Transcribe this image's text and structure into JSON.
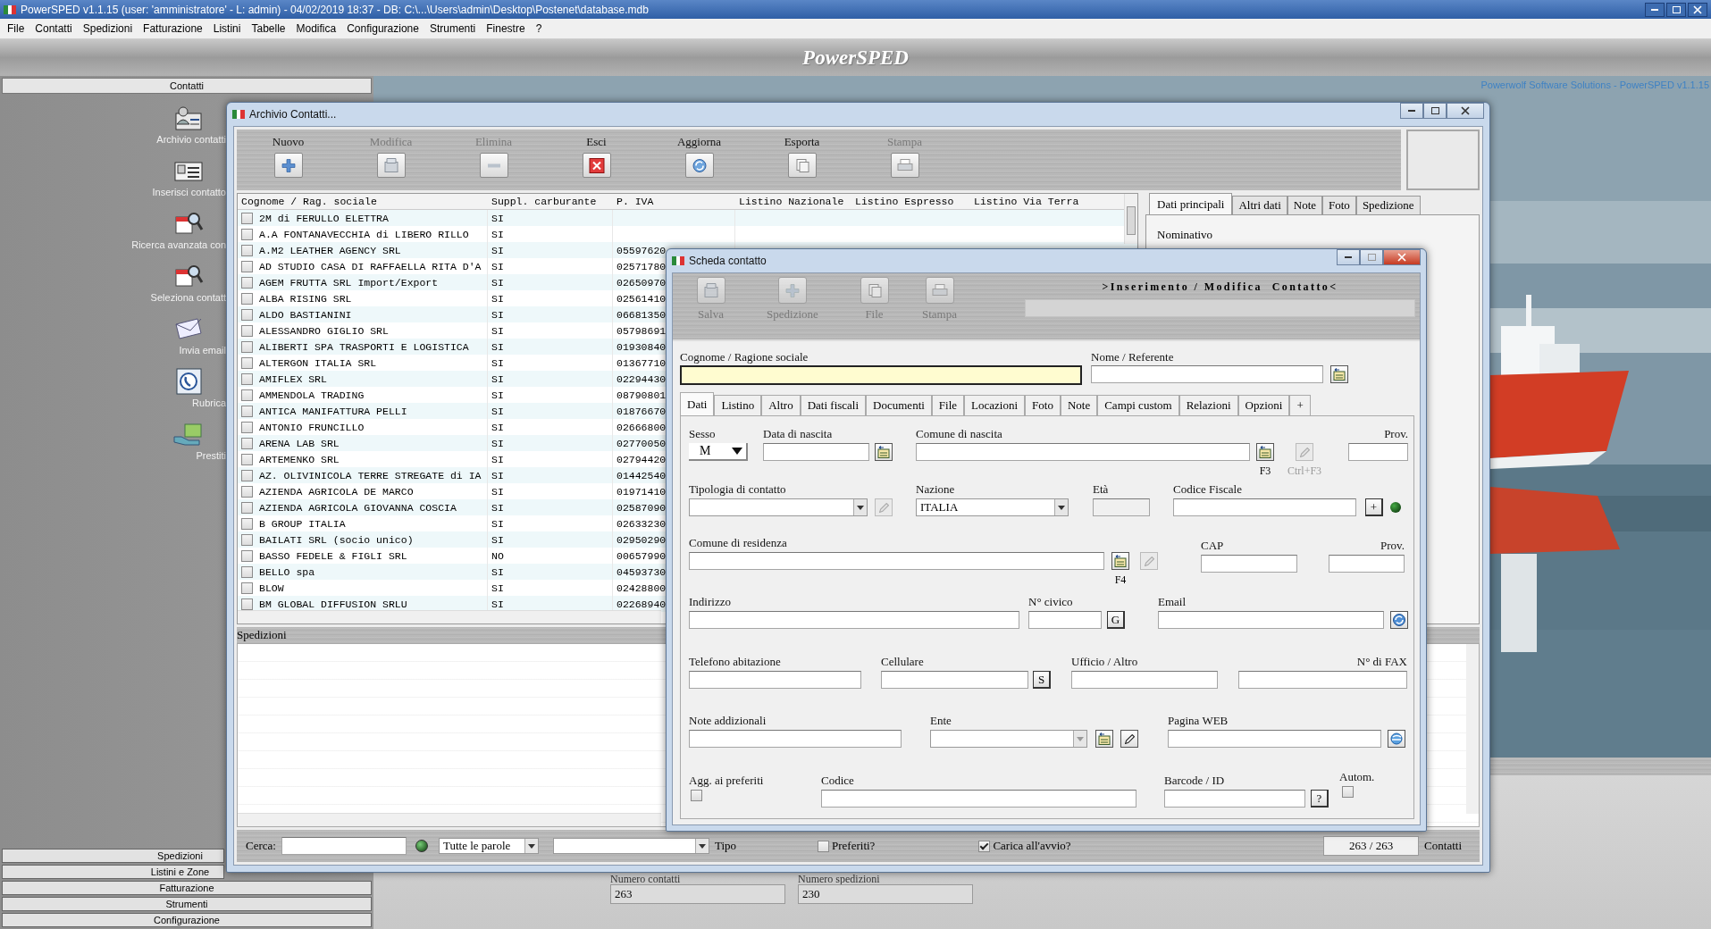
{
  "window": {
    "title": "PowerSPED v1.1.15  (user: 'amministratore'  - L: admin) - 04/02/2019 18:37 - DB: C:\\...\\Users\\admin\\Desktop\\Postenet\\database.mdb"
  },
  "menu": [
    "File",
    "Contatti",
    "Spedizioni",
    "Fatturazione",
    "Listini",
    "Tabelle",
    "Modifica",
    "Configurazione",
    "Strumenti",
    "Finestre",
    "?"
  ],
  "header": {
    "title": "PowerSPED"
  },
  "desktop": {
    "credit": "Powerwolf Software Solutions - PowerSPED v1.1.15"
  },
  "sidebar": {
    "section": "Contatti",
    "items": [
      {
        "label": "Archivio contatti",
        "kind": "contacts"
      },
      {
        "label": "Inserisci contatto",
        "kind": "card"
      },
      {
        "label": "Ricerca avanzata con",
        "kind": "search"
      },
      {
        "label": "Seleziona contatt",
        "kind": "search"
      },
      {
        "label": "Invia email",
        "kind": "email"
      },
      {
        "label": "Rubrica",
        "kind": "phone"
      },
      {
        "label": "Prestiti",
        "kind": "loan"
      }
    ],
    "sections": [
      "Spedizioni",
      "Listini e Zone",
      "Fatturazione",
      "Strumenti",
      "Configurazione"
    ]
  },
  "archive": {
    "title": "Archivio Contatti...",
    "toolbar": [
      {
        "label": "Nuovo",
        "kind": "new",
        "disabled": false
      },
      {
        "label": "Modifica",
        "kind": "edit",
        "disabled": true
      },
      {
        "label": "Elimina",
        "kind": "delete",
        "disabled": true
      },
      {
        "label": "Esci",
        "kind": "exit",
        "disabled": false
      },
      {
        "label": "Aggiorna",
        "kind": "refresh",
        "disabled": false
      },
      {
        "label": "Esporta",
        "kind": "export",
        "disabled": false
      },
      {
        "label": "Stampa",
        "kind": "print",
        "disabled": true
      }
    ],
    "columns": [
      "Cognome / Rag. sociale",
      "Suppl. carburante",
      "P. IVA",
      "Listino Nazionale",
      "Listino Espresso",
      "Listino Via Terra"
    ],
    "rows": [
      {
        "checked": false,
        "name": "2M di FERULLO ELETTRA",
        "fuel": "SI"
      },
      {
        "checked": false,
        "name": "A.A FONTANAVECCHIA di LIBERO RILLO",
        "fuel": "SI"
      },
      {
        "checked": false,
        "name": "A.M2 LEATHER AGENCY SRL",
        "fuel": "SI",
        "vat": "05597620"
      },
      {
        "checked": false,
        "name": "AD STUDIO CASA DI RAFFAELLA RITA D'A",
        "fuel": "SI",
        "vat": "02571780"
      },
      {
        "checked": false,
        "name": "AGEM FRUTTA SRL Import/Export",
        "fuel": "SI",
        "vat": "02650970"
      },
      {
        "checked": false,
        "name": "ALBA RISING SRL",
        "fuel": "SI",
        "vat": "02561410"
      },
      {
        "checked": false,
        "name": "ALDO BASTIANINI",
        "fuel": "SI",
        "vat": "06681350"
      },
      {
        "checked": false,
        "name": "ALESSANDRO GIGLIO SRL",
        "fuel": "SI",
        "vat": "05798691"
      },
      {
        "checked": false,
        "name": "ALIBERTI SPA TRASPORTI E LOGISTICA",
        "fuel": "SI",
        "vat": "01930840"
      },
      {
        "checked": false,
        "name": "ALTERGON ITALIA SRL",
        "fuel": "SI",
        "vat": "01367710"
      },
      {
        "checked": false,
        "name": "AMIFLEX SRL",
        "fuel": "SI",
        "vat": "02294430"
      },
      {
        "checked": false,
        "name": "AMMENDOLA TRADING",
        "fuel": "SI",
        "vat": "08790801"
      },
      {
        "checked": false,
        "name": "ANTICA MANIFATTURA PELLI",
        "fuel": "SI",
        "vat": "01876670"
      },
      {
        "checked": false,
        "name": "ANTONIO FRUNCILLO",
        "fuel": "SI",
        "vat": "02666800"
      },
      {
        "checked": false,
        "name": "ARENA LAB SRL",
        "fuel": "SI",
        "vat": "02770050"
      },
      {
        "checked": false,
        "name": "ARTEMENKO SRL",
        "fuel": "SI",
        "vat": "02794420"
      },
      {
        "checked": false,
        "name": "AZ. OLIVINICOLA TERRE STREGATE di IA",
        "fuel": "SI",
        "vat": "01442540"
      },
      {
        "checked": false,
        "name": "AZIENDA AGRICOLA DE MARCO",
        "fuel": "SI",
        "vat": "01971410"
      },
      {
        "checked": false,
        "name": "AZIENDA AGRICOLA GIOVANNA COSCIA",
        "fuel": "SI",
        "vat": "02587090"
      },
      {
        "checked": false,
        "name": "B GROUP ITALIA",
        "fuel": "SI",
        "vat": "02633230"
      },
      {
        "checked": false,
        "name": "BAILATI SRL (socio unico)",
        "fuel": "SI",
        "vat": "02950290"
      },
      {
        "checked": false,
        "name": "BASSO FEDELE & FIGLI SRL",
        "fuel": "NO",
        "vat": "00657990"
      },
      {
        "checked": false,
        "name": "BELLO spa",
        "fuel": "SI",
        "vat": "04593730"
      },
      {
        "checked": false,
        "name": "BLOW",
        "fuel": "SI",
        "vat": "02428800"
      },
      {
        "checked": false,
        "name": "BM GLOBAL DIFFUSION SRLU",
        "fuel": "SI",
        "vat": "02268940"
      }
    ],
    "detail_tabs": [
      {
        "label": "Dati principali",
        "selected": true
      },
      {
        "label": "Altri dati",
        "selected": false
      },
      {
        "label": "Note",
        "selected": false
      },
      {
        "label": "Foto",
        "selected": false
      },
      {
        "label": "Spedizione",
        "selected": false
      }
    ],
    "detail_label": "Nominativo",
    "shipments_title": "Spedizioni",
    "search": {
      "label": "Cerca:",
      "mode": "Tutte le parole",
      "type_label": "Tipo"
    },
    "favorites": {
      "label": "Preferiti?",
      "checked": false
    },
    "autoload": {
      "label": "Carica all'avvio?",
      "checked": true
    },
    "count": "263 / 263",
    "count_label": "Contatti"
  },
  "stats": [
    {
      "label": "Numero contatti",
      "value": "263"
    },
    {
      "label": "Numero spedizioni",
      "value": "230"
    }
  ],
  "form": {
    "title": "Scheda contatto",
    "heading": ">Inserimento / Modifica  Contatto<",
    "toolbar": [
      {
        "label": "Salva",
        "kind": "save",
        "disabled": true
      },
      {
        "label": "Spedizione",
        "kind": "add",
        "disabled": true
      },
      {
        "label": "File",
        "kind": "file",
        "disabled": true
      },
      {
        "label": "Stampa",
        "kind": "print",
        "disabled": true
      }
    ],
    "name_label": "Cognome / Ragione sociale",
    "referent_label": "Nome /  Referente",
    "tabs": [
      {
        "label": "Dati",
        "selected": true
      },
      {
        "label": "Listino",
        "selected": false
      },
      {
        "label": "Altro",
        "selected": false
      },
      {
        "label": "Dati fiscali",
        "selected": false
      },
      {
        "label": "Documenti",
        "selected": false
      },
      {
        "label": "File",
        "selected": false
      },
      {
        "label": "Locazioni",
        "selected": false
      },
      {
        "label": "Foto",
        "selected": false
      },
      {
        "label": "Note",
        "selected": false
      },
      {
        "label": "Campi custom",
        "selected": false
      },
      {
        "label": "Relazioni",
        "selected": false
      },
      {
        "label": "Opzioni",
        "selected": false
      },
      {
        "label": "+",
        "selected": false
      }
    ],
    "sex": {
      "label": "Sesso",
      "value": "M"
    },
    "birth_date": {
      "label": "Data di nascita"
    },
    "birth_town": {
      "label": "Comune di nascita",
      "lookup_key": "F3",
      "edit_key": "Ctrl+F3",
      "edit_disabled": true
    },
    "birth_prov": {
      "label": "Prov."
    },
    "contact_type": {
      "label": "Tipologia di contatto",
      "edit_disabled": true
    },
    "country": {
      "label": "Nazione",
      "value": "ITALIA"
    },
    "age": {
      "label": "Età"
    },
    "tax_code": {
      "label": "Codice Fiscale",
      "button": "+"
    },
    "res_town": {
      "label": "Comune di residenza",
      "lookup_key": "F4",
      "edit_disabled": true
    },
    "cap": {
      "label": "CAP"
    },
    "res_prov": {
      "label": "Prov."
    },
    "address": {
      "label": "Indirizzo"
    },
    "civic": {
      "label": "N° civico",
      "button": "G"
    },
    "email": {
      "label": "Email"
    },
    "home_phone": {
      "label": "Telefono abitazione"
    },
    "mobile": {
      "label": "Cellulare",
      "button": "S"
    },
    "office": {
      "label": "Ufficio / Altro"
    },
    "fax": {
      "label": "N° di FAX"
    },
    "notes": {
      "label": "Note addizionali"
    },
    "entity": {
      "label": "Ente",
      "edit_disabled": false
    },
    "web": {
      "label": "Pagina WEB"
    },
    "favorite": {
      "label": "Agg. ai preferiti",
      "checked": false
    },
    "code": {
      "label": "Codice"
    },
    "barcode": {
      "label": "Barcode / ID",
      "button": "?"
    },
    "auto": {
      "label": "Autom.",
      "checked": false
    }
  }
}
